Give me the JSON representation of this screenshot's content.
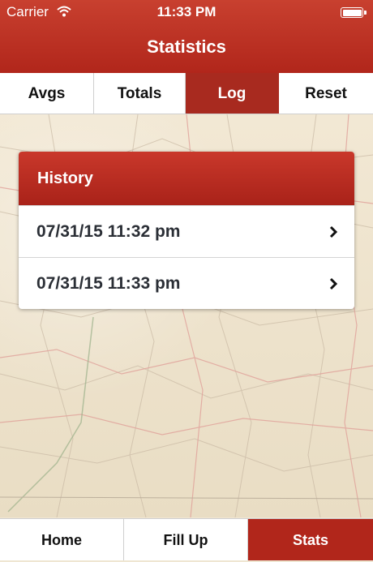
{
  "status_bar": {
    "carrier": "Carrier",
    "time": "11:33 PM"
  },
  "nav": {
    "title": "Statistics"
  },
  "segments": [
    {
      "label": "Avgs",
      "active": false
    },
    {
      "label": "Totals",
      "active": false
    },
    {
      "label": "Log",
      "active": true
    },
    {
      "label": "Reset",
      "active": false
    }
  ],
  "history": {
    "title": "History",
    "entries": [
      {
        "label": "07/31/15 11:32 pm"
      },
      {
        "label": "07/31/15 11:33 pm"
      }
    ]
  },
  "tabbar": [
    {
      "label": "Home",
      "active": false
    },
    {
      "label": "Fill Up",
      "active": false
    },
    {
      "label": "Stats",
      "active": true
    }
  ],
  "colors": {
    "brand_red": "#b1261b",
    "active_tab": "#a82a1f"
  }
}
